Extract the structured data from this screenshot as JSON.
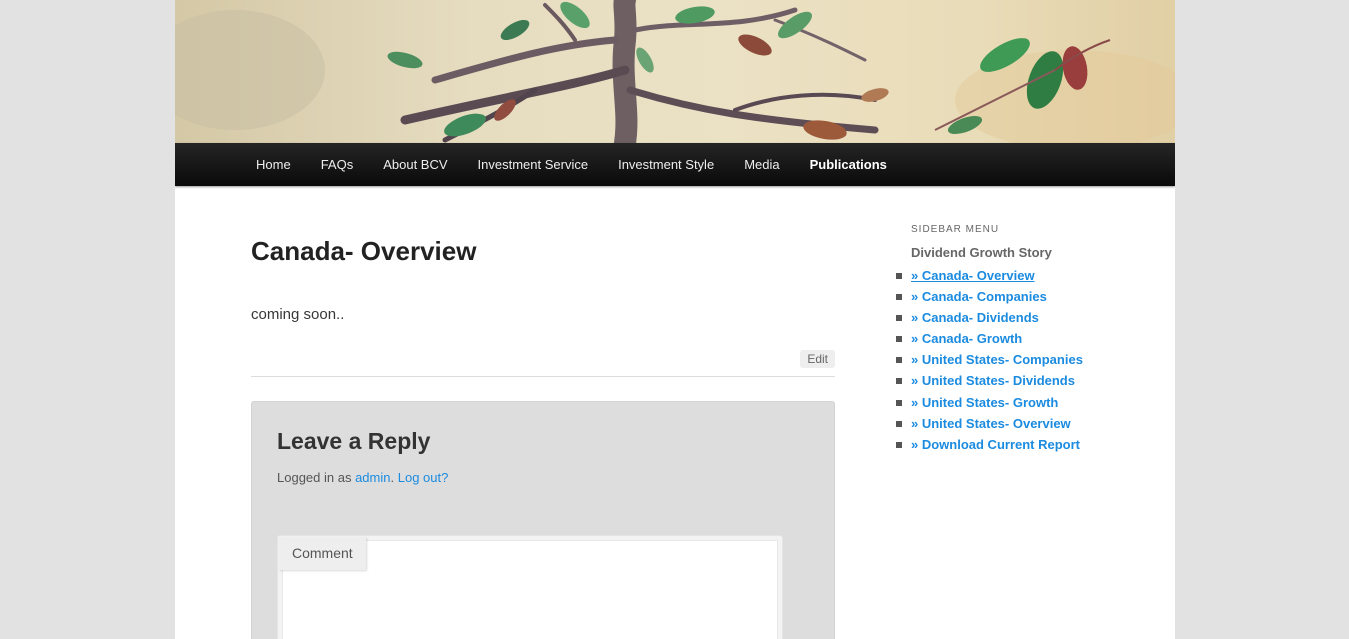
{
  "nav": {
    "items": [
      {
        "label": "Home"
      },
      {
        "label": "FAQs"
      },
      {
        "label": "About BCV"
      },
      {
        "label": "Investment Service"
      },
      {
        "label": "Investment Style"
      },
      {
        "label": "Media"
      },
      {
        "label": "Publications"
      }
    ],
    "current_index": 6
  },
  "main": {
    "title": "Canada- Overview",
    "content": "coming soon..",
    "edit_label": "Edit"
  },
  "reply": {
    "title": "Leave a Reply",
    "logged_in_prefix": "Logged in as",
    "user": "admin",
    "logout_label": "Log out?",
    "comment_label": "Comment"
  },
  "sidebar": {
    "widget_title": "Sidebar Menu",
    "heading": "Dividend Growth Story",
    "items": [
      {
        "label": "» Canada- Overview"
      },
      {
        "label": "» Canada- Companies"
      },
      {
        "label": "» Canada- Dividends"
      },
      {
        "label": "» Canada- Growth"
      },
      {
        "label": "» United States- Companies"
      },
      {
        "label": "» United States- Dividends"
      },
      {
        "label": "» United States- Growth"
      },
      {
        "label": "» United States- Overview"
      },
      {
        "label": "» Download Current Report"
      }
    ]
  },
  "colors": {
    "link": "#1b8be0",
    "nav_background": "#111111",
    "page_background": "#e2e2e2"
  }
}
